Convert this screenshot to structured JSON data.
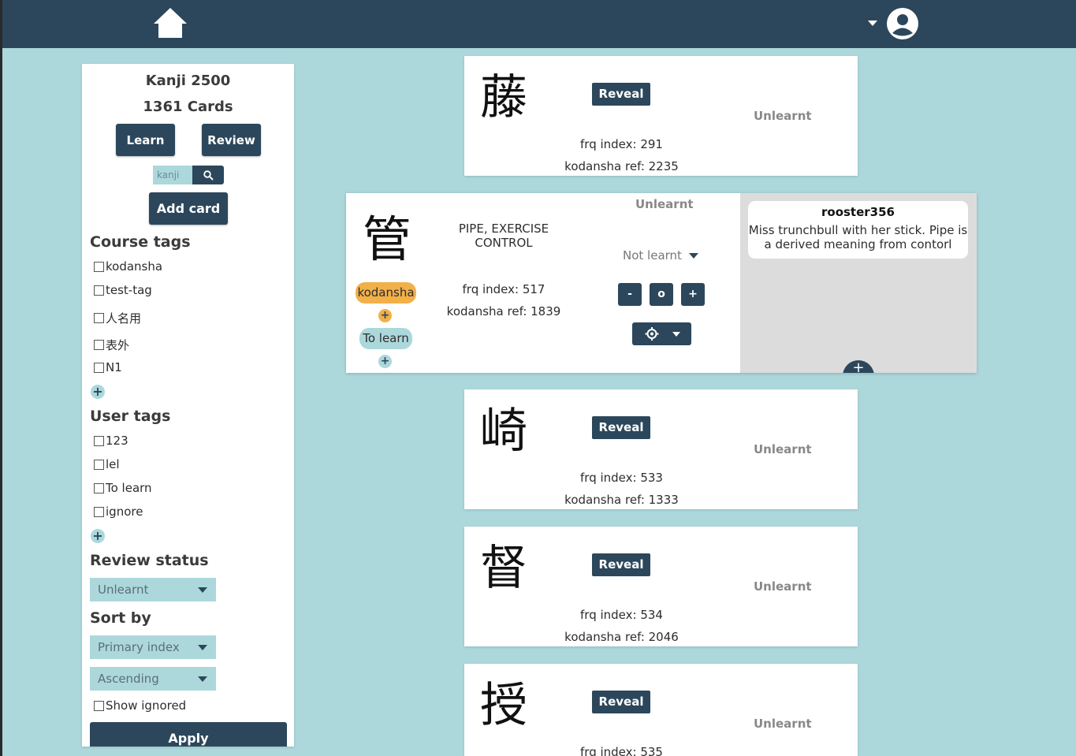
{
  "nav": {
    "home_icon": "home-icon",
    "account_icon": "user-circle-icon"
  },
  "sidebar": {
    "deck_title": "Kanji 2500",
    "card_count": "1361 Cards",
    "learn_label": "Learn",
    "review_label": "Review",
    "search_placeholder": "kanji",
    "add_card_label": "Add card",
    "course_tags_heading": "Course tags",
    "course_tags": [
      "kodansha",
      "test-tag",
      "人名用",
      "表外",
      "N1"
    ],
    "user_tags_heading": "User tags",
    "user_tags": [
      "123",
      "lel",
      "To learn",
      "ignore"
    ],
    "review_status_heading": "Review status",
    "review_status_value": "Unlearnt",
    "sort_heading": "Sort by",
    "sort_value": "Primary index",
    "order_value": "Ascending",
    "show_ignored_label": "Show ignored",
    "apply_label": "Apply"
  },
  "cards": [
    {
      "kanji": "藤",
      "reveal": "Reveal",
      "status": "Unlearnt",
      "frq": "frq index: 291",
      "ref": "kodansha ref: 2235"
    },
    {
      "kanji": "崎",
      "reveal": "Reveal",
      "status": "Unlearnt",
      "frq": "frq index: 533",
      "ref": "kodansha ref: 1333"
    },
    {
      "kanji": "督",
      "reveal": "Reveal",
      "status": "Unlearnt",
      "frq": "frq index: 534",
      "ref": "kodansha ref: 2046"
    },
    {
      "kanji": "授",
      "reveal": "Reveal",
      "status": "Unlearnt",
      "frq": "frq index: 535",
      "ref": ""
    }
  ],
  "expanded": {
    "kanji": "管",
    "meaning": "PIPE, EXERCISE CONTROL",
    "frq": "frq index: 517",
    "ref": "kodansha ref: 1839",
    "status": "Unlearnt",
    "learn_state": "Not learnt",
    "course_tag": "kodansha",
    "user_tag": "To learn",
    "minus": "-",
    "zero": "o",
    "plus": "+",
    "comment_user": "rooster356",
    "comment_text": "Miss trunchbull with her stick. Pipe is a derived meaning from contorl"
  },
  "colors": {
    "accent": "#2c475b",
    "background": "#acd8dc",
    "course_tag": "#f2b049",
    "user_tag": "#acd8dc"
  }
}
